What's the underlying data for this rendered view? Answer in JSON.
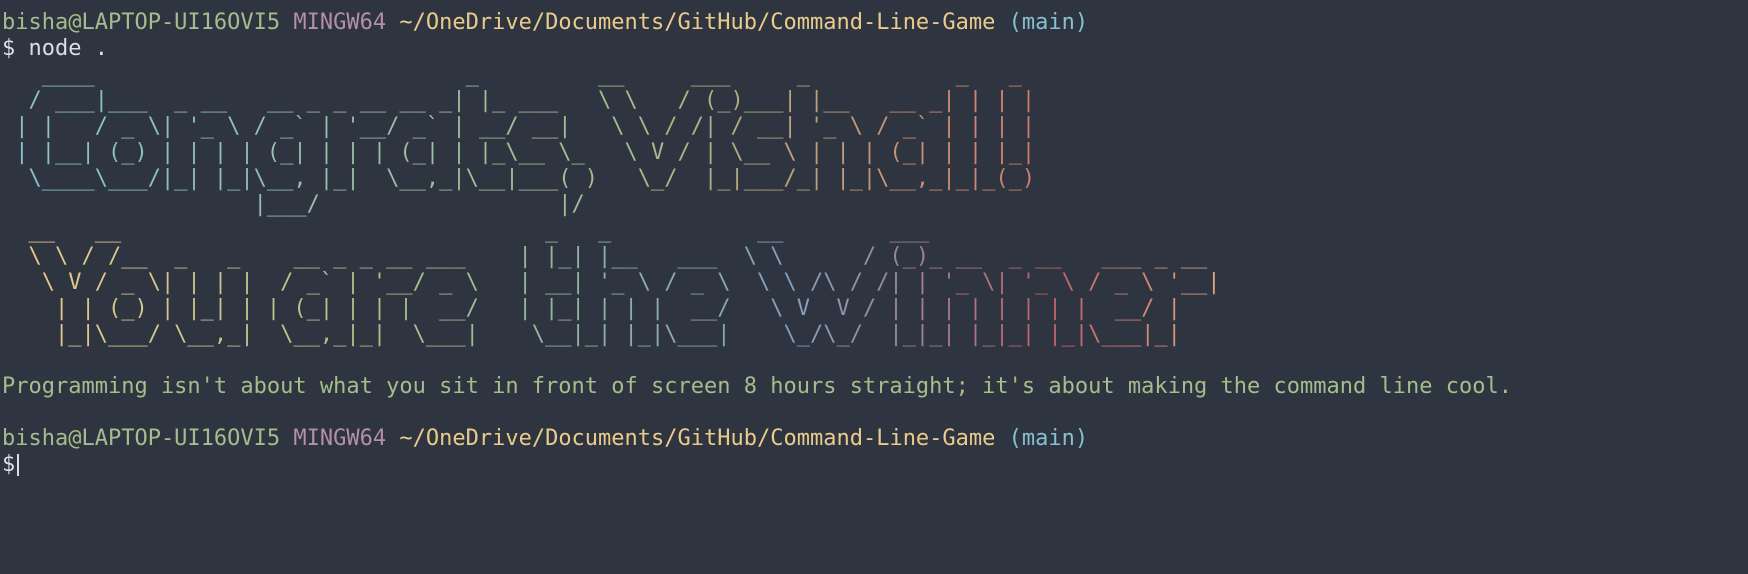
{
  "prompt1": {
    "user_host": "bisha@LAPTOP-UI16OVI5",
    "system": "MINGW64",
    "path": "~/OneDrive/Documents/GitHub/Command-Line-Game",
    "branch": "(main)"
  },
  "command": {
    "symbol": "$",
    "text": "node ."
  },
  "banner": {
    "line1_art": "   ____                            _         __     ___     _           _   _ \n  / ___|___  _ __   __ _ _ __ __ _| |_ ___   \\ \\   / (_)___| |__   __ _| | | |\n | |   / _ \\| '_ \\ / _` | '__/ _` | __/ __|   \\ \\ / /| / __| '_ \\ / _` | | | |\n | |__| (_) | | | | (_| | | | (_| | |_\\__ \\_   \\ V / | \\__ \\ | | | (_| | | |_|\n  \\____\\___/|_| |_|\\__, |_|  \\__,_|\\__|___( )   \\_/  |_|___/_| |_|\\__,_|_|_(_)\n                   |___/                  |/                                  ",
    "line2_art": "  __   __                                _   _           __        ___                       \n  \\ \\ / /__  _   _    __ _ _ __ ___    | |_| |__   ___  \\ \\      / (_)_ __  _ __   ___ _ __ \n   \\ V / _ \\| | | |  / _` | '__/ _ \\   | __| '_ \\ / _ \\  \\ \\ /\\ / /| | '_ \\| '_ \\ / _ \\ '__|\n    | | (_) | |_| | | (_| | | |  __/   | |_| | | |  __/   \\ V  V / | | | | | | | |  __/ |   \n    |_|\\___/ \\__,_|  \\__,_|_|  \\___|    \\__|_| |_|\\___|    \\_/\\_/  |_|_| |_|_| |_|\\___|_|   "
  },
  "message": "Programming isn't about what you sit in front of screen 8 hours straight; it's about making the command line cool.",
  "prompt2": {
    "user_host": "bisha@LAPTOP-UI16OVI5",
    "system": "MINGW64",
    "path": "~/OneDrive/Documents/GitHub/Command-Line-Game",
    "branch": "(main)",
    "symbol": "$"
  },
  "colors": {
    "background": "#2e3440",
    "user": "#a3be8c",
    "system": "#b48ead",
    "path": "#ebcb8b",
    "branch": "#88c0d0"
  }
}
